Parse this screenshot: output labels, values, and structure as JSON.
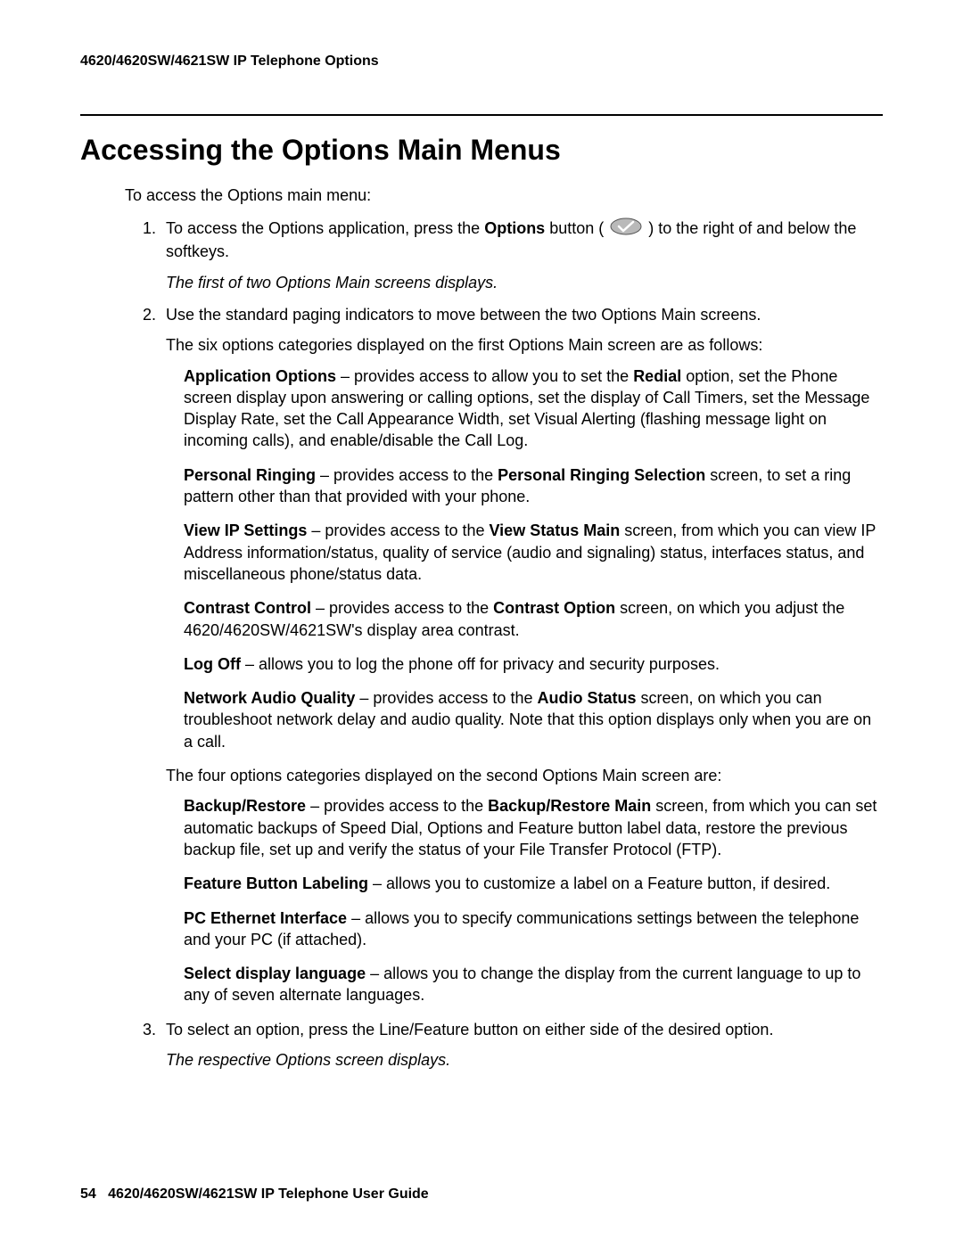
{
  "header": {
    "running": "4620/4620SW/4621SW IP Telephone Options"
  },
  "title": "Accessing the Options Main Menus",
  "intro": "To access the Options main menu:",
  "steps": {
    "s1": {
      "num": "1.",
      "pre": "To access the Options application, press the ",
      "bold1": "Options",
      "mid": " button ( ",
      "post": " ) to the right of and below the softkeys.",
      "result": "The first of two Options Main screens displays."
    },
    "s2": {
      "num": "2.",
      "line1": "Use the standard paging indicators to move between the two Options Main screens.",
      "line2": "The six options categories displayed on the first Options Main screen are as follows:",
      "opts_a": {
        "app": {
          "label": "Application Options",
          "pre": " – provides access to allow you to set the ",
          "b1": "Redial",
          "post": " option, set the Phone screen display upon answering or calling options, set the display of Call Timers, set the Message Display Rate, set the Call Appearance Width, set Visual Alerting (flashing message light on incoming calls), and enable/disable the Call Log."
        },
        "ring": {
          "label": "Personal Ringing",
          "pre": " – provides access to the ",
          "b1": "Personal Ringing Selection",
          "post": " screen, to set a ring pattern other than that provided with your phone."
        },
        "ip": {
          "label": "View IP Settings",
          "pre": " – provides access to the ",
          "b1": "View Status Main",
          "post": " screen, from which you can view IP Address information/status, quality of service (audio and signaling) status, interfaces status, and miscellaneous phone/status data."
        },
        "contrast": {
          "label": "Contrast Control",
          "pre": " – provides access to the ",
          "b1": "Contrast Option",
          "post": " screen, on which you adjust the 4620/4620SW/4621SW's display area contrast."
        },
        "logoff": {
          "label": "Log Off",
          "post": " – allows you to log the phone off for privacy and security purposes."
        },
        "audio": {
          "label": "Network Audio Quality",
          "pre": " – provides access to the ",
          "b1": "Audio Status",
          "post": " screen, on which you can troubleshoot network delay and audio quality. Note that this option displays only when you are on a call."
        }
      },
      "line3": "The four options categories displayed on the second Options Main screen are:",
      "opts_b": {
        "backup": {
          "label": "Backup/Restore",
          "pre": " – provides access to the ",
          "b1": "Backup/Restore Main",
          "post": " screen, from which you can set automatic backups of Speed Dial, Options and Feature button label data, restore the previous backup file, set up and verify the status of your File Transfer Protocol (FTP)."
        },
        "feature": {
          "label": "Feature Button Labeling",
          "post": " – allows you to customize a label on a Feature button, if desired."
        },
        "pc": {
          "label": "PC Ethernet Interface",
          "post": " – allows you to specify communications settings between the telephone and your PC (if attached)."
        },
        "lang": {
          "label": "Select display language",
          "post": " – allows you to change the display from the current language to up to any of seven alternate languages."
        }
      }
    },
    "s3": {
      "num": "3.",
      "line1": "To select an option, press the Line/Feature button on either side of the desired option.",
      "result": "The respective Options screen displays."
    }
  },
  "footer": {
    "page": "54",
    "guide": "4620/4620SW/4621SW IP Telephone User Guide"
  }
}
